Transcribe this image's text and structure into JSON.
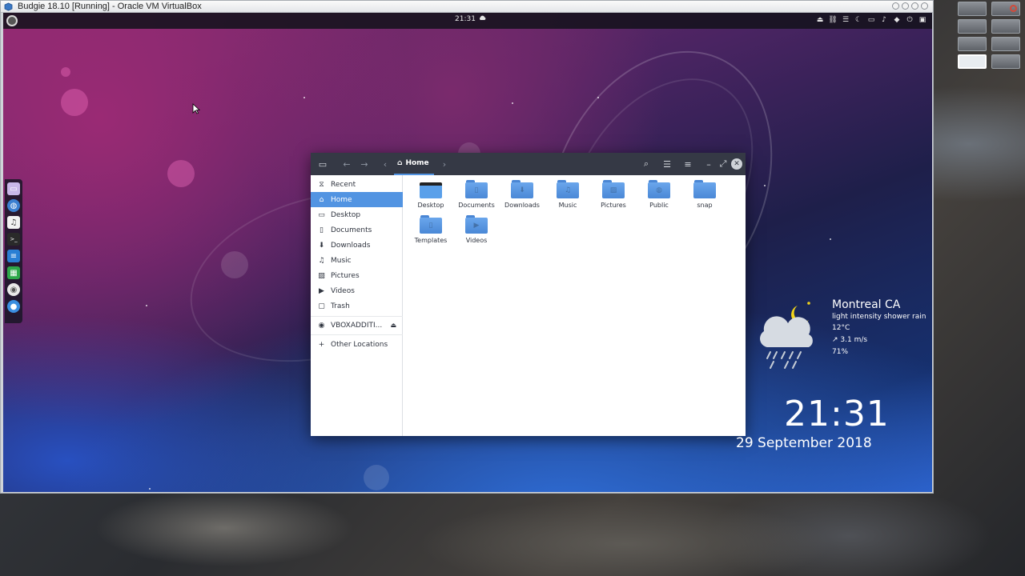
{
  "vbox": {
    "title": "Budgie 18.10 [Running] - Oracle VM VirtualBox"
  },
  "panel": {
    "clock": "21:31"
  },
  "dock": {
    "items": [
      "files-icon",
      "browser-icon",
      "music-icon",
      "terminal-icon",
      "writer-icon",
      "calc-icon",
      "chrome-icon",
      "chat-icon"
    ]
  },
  "files": {
    "path_label": "Home",
    "sidebar": [
      {
        "label": "Recent",
        "icon": "clock-icon"
      },
      {
        "label": "Home",
        "icon": "home-icon",
        "active": true
      },
      {
        "label": "Desktop",
        "icon": "desktop-icon"
      },
      {
        "label": "Documents",
        "icon": "document-icon"
      },
      {
        "label": "Downloads",
        "icon": "download-icon"
      },
      {
        "label": "Music",
        "icon": "music-icon"
      },
      {
        "label": "Pictures",
        "icon": "picture-icon"
      },
      {
        "label": "Videos",
        "icon": "video-icon"
      },
      {
        "label": "Trash",
        "icon": "trash-icon"
      },
      {
        "label": "VBOXADDITI...",
        "icon": "disc-icon"
      },
      {
        "label": "Other Locations",
        "icon": "plus-icon"
      }
    ],
    "folders": [
      "Desktop",
      "Documents",
      "Downloads",
      "Music",
      "Pictures",
      "Public",
      "snap",
      "Templates",
      "Videos"
    ]
  },
  "weather": {
    "city": "Montreal CA",
    "condition": "light intensity shower rain",
    "temp": "12°C",
    "wind": "↗ 3.1 m/s",
    "humidity": "71%"
  },
  "clock": {
    "time": "21:31",
    "date": "29 September 2018"
  },
  "colors": {
    "accent": "#5294e2",
    "header": "#353945",
    "folder": "#5a9be6"
  }
}
